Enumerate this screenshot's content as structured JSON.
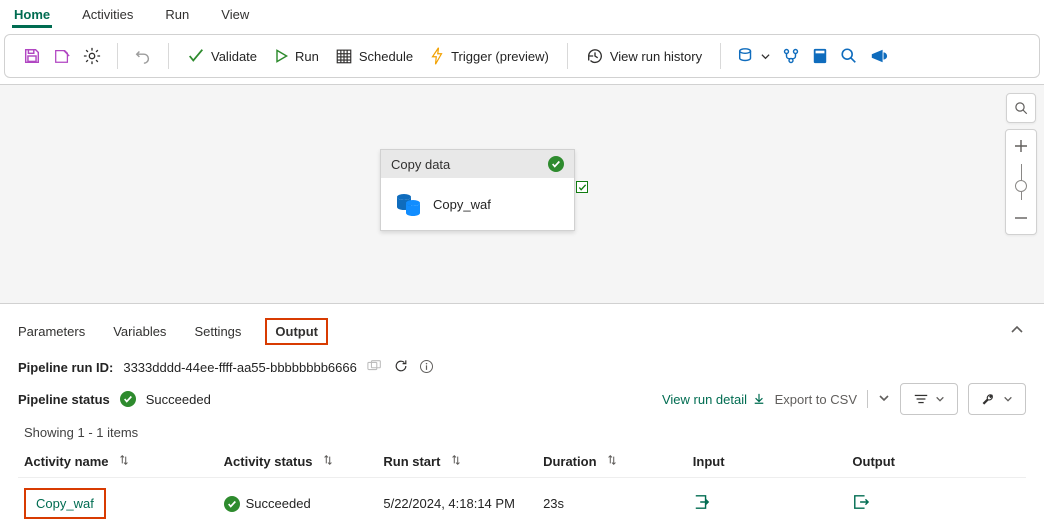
{
  "menubar": {
    "home": "Home",
    "activities": "Activities",
    "run": "Run",
    "view": "View"
  },
  "toolbar": {
    "validate": "Validate",
    "run": "Run",
    "schedule": "Schedule",
    "trigger": "Trigger (preview)",
    "view_history": "View run history"
  },
  "canvas": {
    "activity_type": "Copy data",
    "activity_name": "Copy_waf"
  },
  "panel_tabs": {
    "parameters": "Parameters",
    "variables": "Variables",
    "settings": "Settings",
    "output": "Output"
  },
  "output": {
    "run_id_label": "Pipeline run ID:",
    "run_id_value": "3333dddd-44ee-ffff-aa55-bbbbbbbb6666",
    "status_label": "Pipeline status",
    "status_value": "Succeeded",
    "view_run_detail": "View run detail",
    "export_csv": "Export to CSV",
    "items_text": "Showing 1 - 1 items",
    "headers": {
      "activity_name": "Activity name",
      "activity_status": "Activity status",
      "run_start": "Run start",
      "duration": "Duration",
      "input": "Input",
      "output": "Output"
    },
    "row": {
      "activity_name": "Copy_waf",
      "activity_status": "Succeeded",
      "run_start": "5/22/2024, 4:18:14 PM",
      "duration": "23s"
    }
  },
  "colors": {
    "accent": "#006c51",
    "success": "#2e8b2e",
    "highlight": "#d83b01"
  }
}
